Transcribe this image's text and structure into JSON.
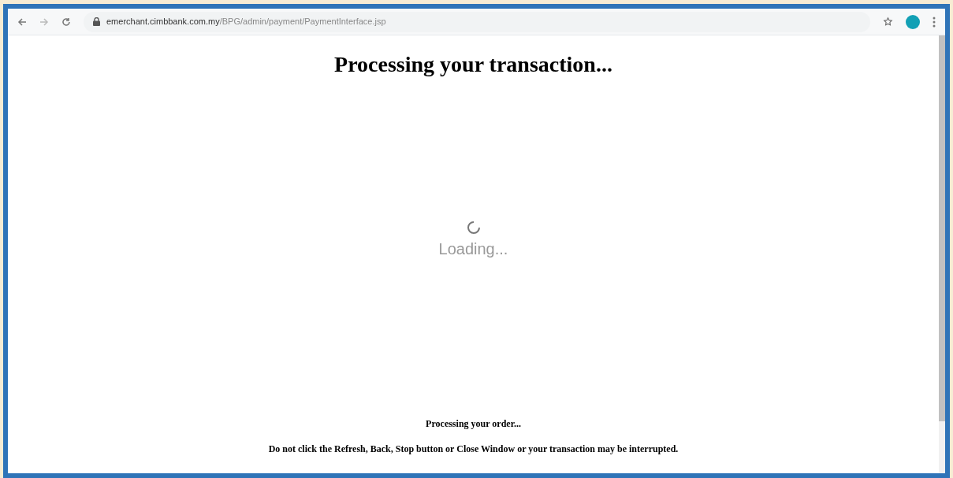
{
  "browser": {
    "url_host": "emerchant.cimbbank.com.my",
    "url_path": "/BPG/admin/payment/PaymentInterface.jsp"
  },
  "page": {
    "heading": "Processing your transaction...",
    "loading_text": "Loading...",
    "order_text": "Processing your order...",
    "warning": "Do not click the Refresh, Back, Stop button or Close Window or your transaction may be interrupted."
  }
}
